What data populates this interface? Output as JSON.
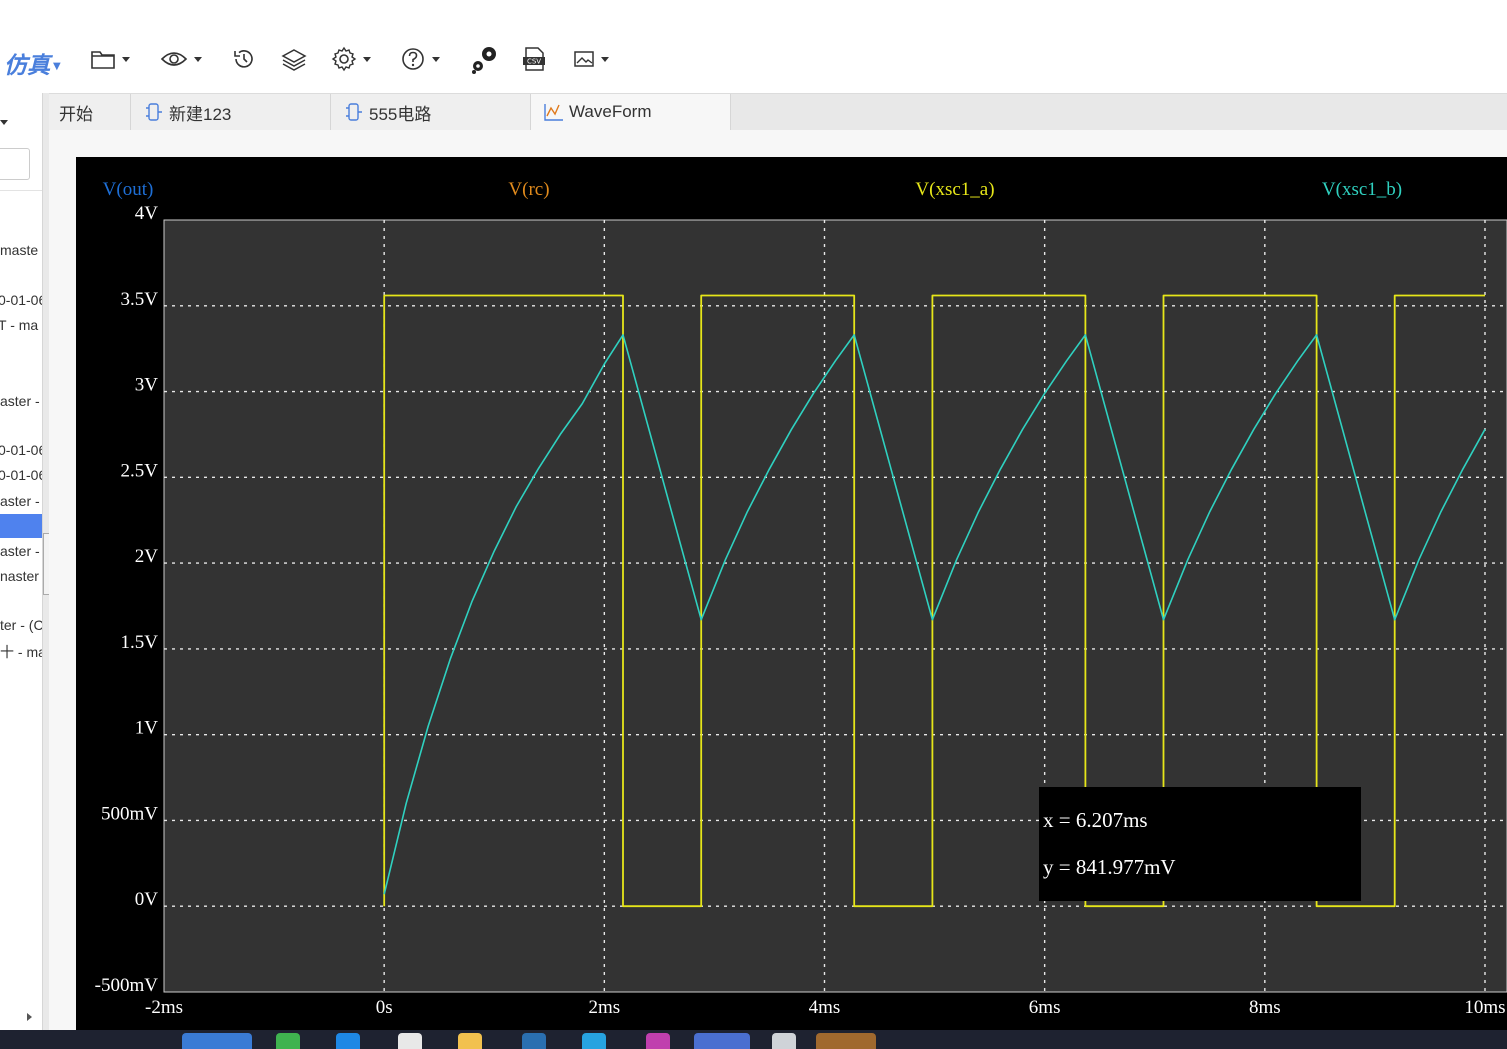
{
  "toolbar": {
    "simulate_label": "仿真",
    "icons": [
      "folder-icon",
      "eye-icon",
      "history-icon",
      "layers-icon",
      "settings-icon",
      "help-icon",
      "gears-icon",
      "csv-export-icon",
      "image-icon"
    ],
    "csv_label": "CSV"
  },
  "left_panel": {
    "items": [
      "maste",
      "0-01-06",
      "T - ma",
      "aster -",
      "0-01-06",
      "0-01-06",
      "aster -",
      "",
      "aster -",
      "naster",
      "ter - (C",
      "十 - ma"
    ]
  },
  "tabs": [
    {
      "label": "开始",
      "icon": ""
    },
    {
      "label": "新建123",
      "icon": "schematic-icon"
    },
    {
      "label": "555电路",
      "icon": "schematic-icon"
    },
    {
      "label": "WaveForm",
      "icon": "waveform-icon"
    }
  ],
  "colors": {
    "plot_bg": "#333333",
    "frame_bg": "#000000",
    "vout": "#1e6fd6",
    "vrc": "#e08a1c",
    "xsc1_a": "#e6e619",
    "xsc1_b": "#2fd1c0",
    "accent": "#4a7fdc"
  },
  "chart_data": {
    "type": "line",
    "legend": [
      "V(out)",
      "V(rc)",
      "V(xsc1_a)",
      "V(xsc1_b)"
    ],
    "xlim": [
      -2,
      10.2
    ],
    "ylim": [
      -0.5,
      4
    ],
    "x_ticks": [
      "-2ms",
      "0s",
      "2ms",
      "4ms",
      "6ms",
      "8ms",
      "10ms"
    ],
    "x_tick_values": [
      -2,
      0,
      2,
      4,
      6,
      8,
      10
    ],
    "y_ticks": [
      "4V",
      "3.5V",
      "3V",
      "2.5V",
      "2V",
      "1.5V",
      "1V",
      "500mV",
      "0V",
      "-500mV"
    ],
    "y_tick_values": [
      4,
      3.5,
      3,
      2.5,
      2,
      1.5,
      1,
      0.5,
      0,
      -0.5
    ],
    "grid": true,
    "series": [
      {
        "name": "V(xsc1_a)",
        "color": "#e6e619",
        "x": [
          0,
          0,
          2.17,
          2.17,
          2.88,
          2.88,
          4.27,
          4.27,
          4.98,
          4.98,
          6.37,
          6.37,
          7.08,
          7.08,
          8.47,
          8.47,
          9.18,
          9.18,
          10
        ],
        "y": [
          0,
          3.56,
          3.56,
          0,
          0,
          3.56,
          3.56,
          0,
          0,
          3.56,
          3.56,
          0,
          0,
          3.56,
          3.56,
          0,
          0,
          3.56,
          3.56
        ]
      },
      {
        "name": "V(xsc1_b)",
        "color": "#2fd1c0",
        "x": [
          0,
          0.2,
          0.4,
          0.6,
          0.8,
          1.0,
          1.2,
          1.4,
          1.6,
          1.8,
          2.0,
          2.17,
          2.88,
          3.1,
          3.3,
          3.5,
          3.7,
          3.9,
          4.1,
          4.27,
          4.98,
          5.2,
          5.4,
          5.6,
          5.8,
          6.0,
          6.2,
          6.37,
          7.08,
          7.3,
          7.5,
          7.7,
          7.9,
          8.1,
          8.3,
          8.47,
          9.18,
          9.4,
          9.6,
          9.8,
          10.0
        ],
        "y": [
          0.07,
          0.6,
          1.05,
          1.44,
          1.78,
          2.07,
          2.33,
          2.55,
          2.75,
          2.93,
          3.16,
          3.33,
          1.67,
          2.02,
          2.3,
          2.55,
          2.78,
          2.99,
          3.18,
          3.33,
          1.67,
          2.02,
          2.3,
          2.55,
          2.78,
          2.99,
          3.18,
          3.33,
          1.67,
          2.02,
          2.3,
          2.55,
          2.78,
          2.99,
          3.18,
          3.33,
          1.67,
          2.02,
          2.3,
          2.55,
          2.78
        ]
      }
    ],
    "cursor": {
      "x_label": "x = 6.207ms",
      "y_label": "y = 841.977mV"
    }
  }
}
